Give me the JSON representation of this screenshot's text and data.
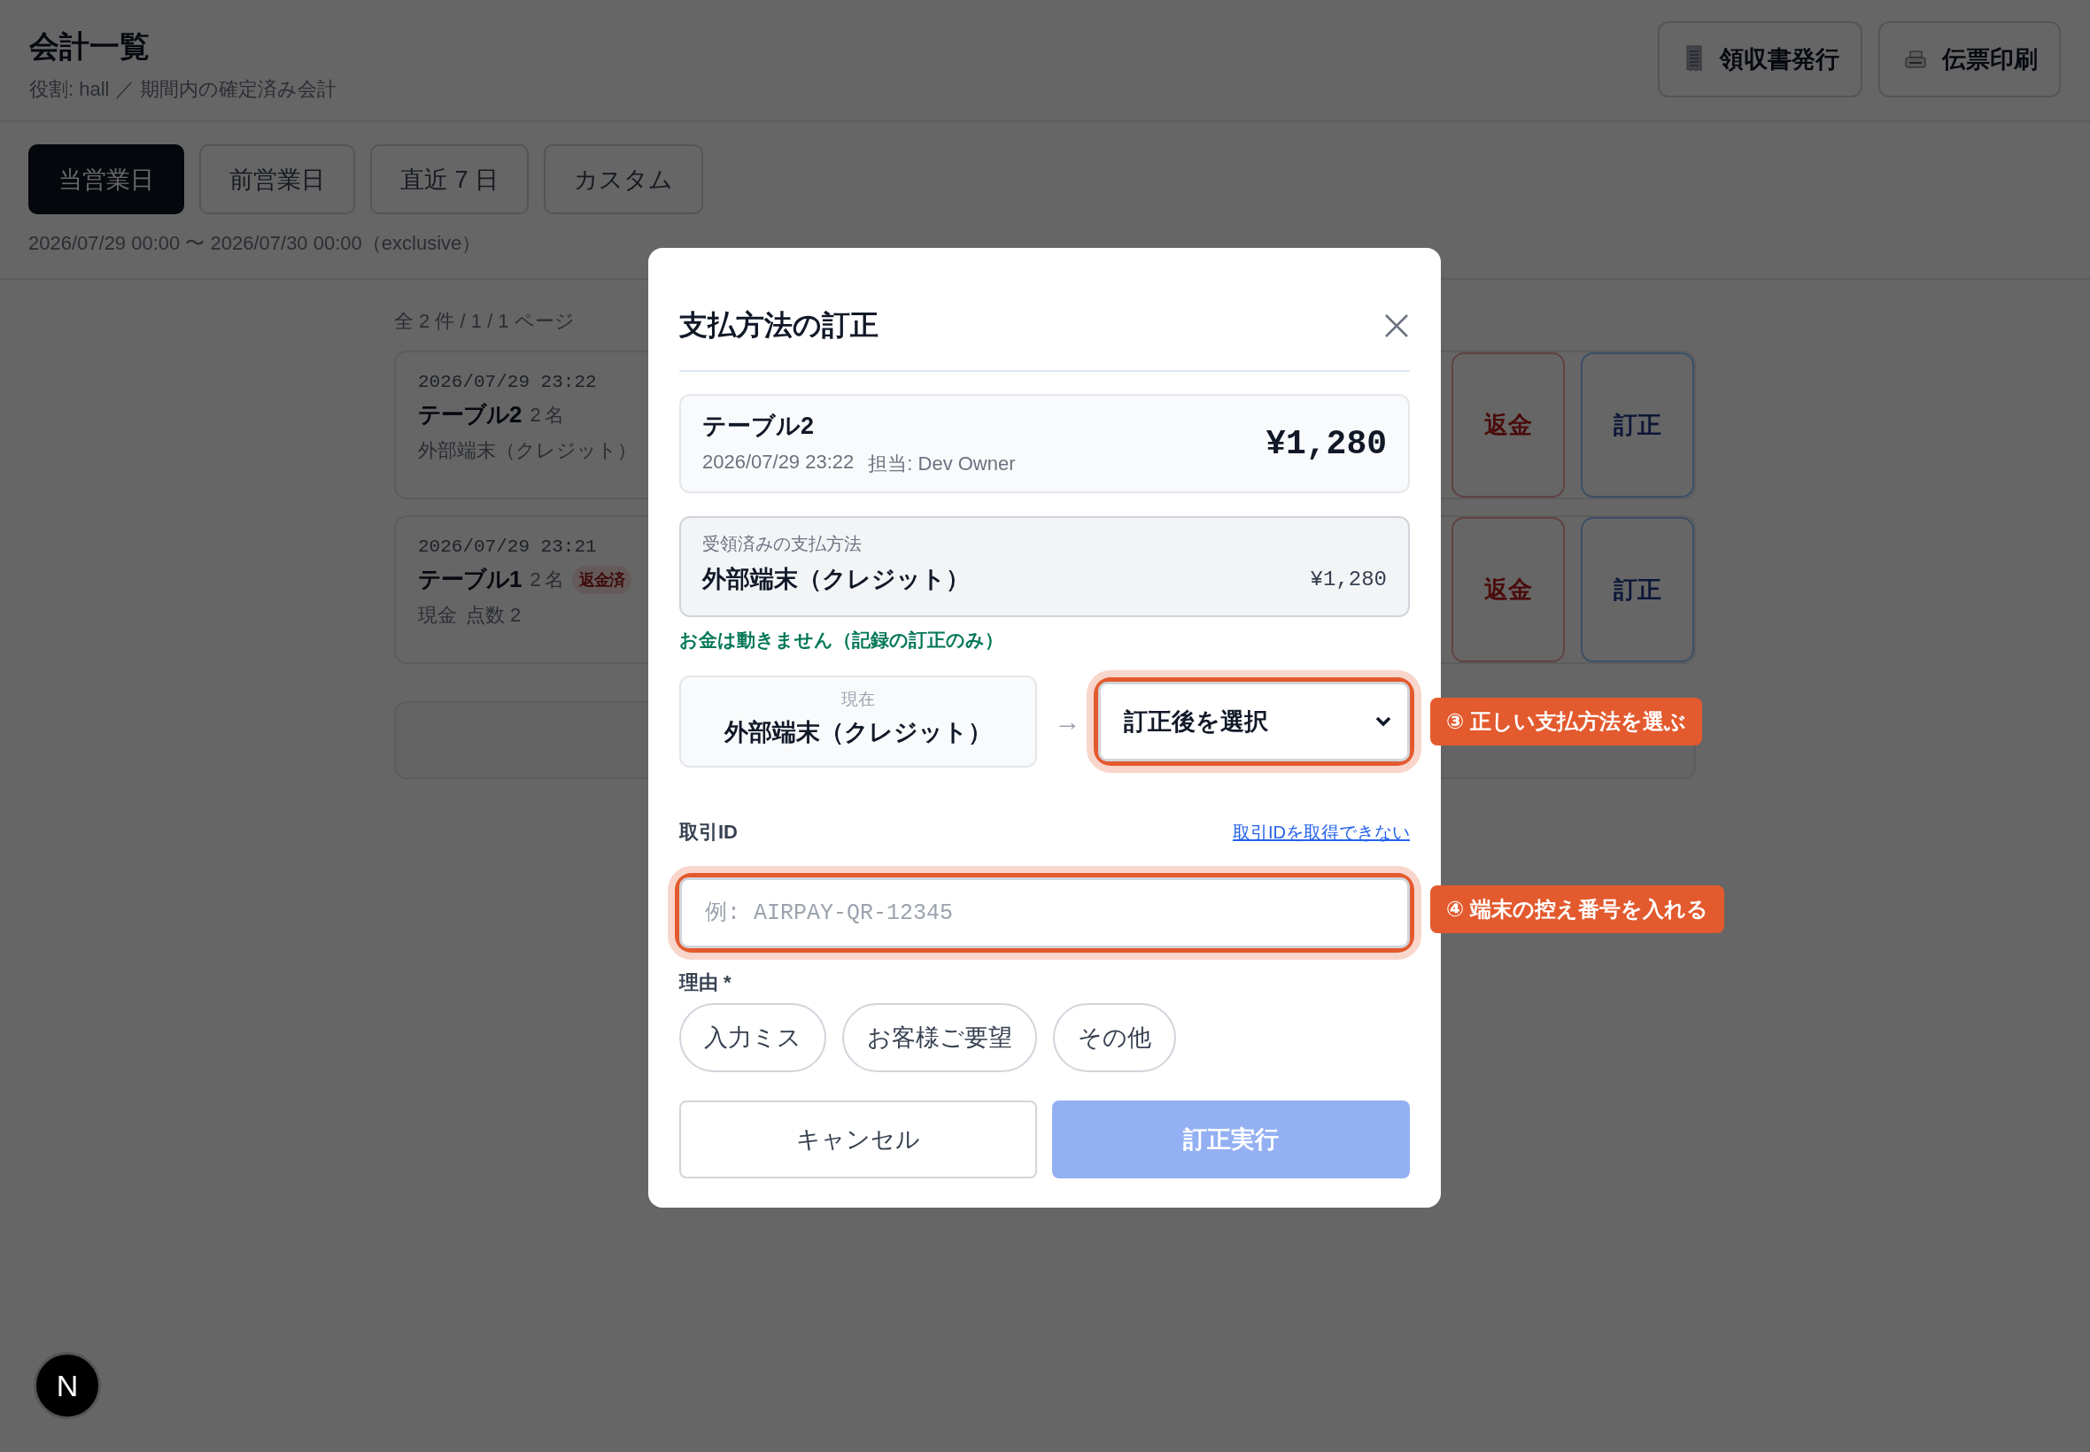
{
  "header": {
    "title": "会計一覧",
    "subtitle": "役割: hall ／ 期間内の確定済み会計"
  },
  "header_actions": [
    {
      "label": "領収書発行",
      "kind": "receipt"
    },
    {
      "label": "伝票印刷",
      "kind": "printer"
    }
  ],
  "period_tabs": [
    {
      "label": "当営業日",
      "selected": true
    },
    {
      "label": "前営業日",
      "selected": false
    },
    {
      "label": "直近 7 日",
      "selected": false
    },
    {
      "label": "カスタム",
      "selected": false
    }
  ],
  "period_range": "2026/07/29 00:00 〜 2026/07/30 00:00（exclusive）",
  "orders": {
    "summary": "全 2 件 / 1 / 1 ページ",
    "cards": [
      {
        "kind": "order",
        "time": "2026/07/29 23:22",
        "table": "テーブル2",
        "guests": "2 名",
        "payment": "外部端末（クレジット）",
        "actions": [
          {
            "label": "返金",
            "kind": "refund"
          },
          {
            "label": "訂正",
            "kind": "correct"
          }
        ]
      },
      {
        "kind": "order",
        "time": "2026/07/29 23:21",
        "table": "テーブル1",
        "guests": "2 名",
        "badge": "返金済",
        "payment": "現金",
        "items": "点数 2",
        "actions": [
          {
            "label": "返金",
            "kind": "refund"
          },
          {
            "label": "訂正",
            "kind": "correct"
          }
        ]
      },
      {
        "kind": "blank"
      }
    ]
  },
  "dialog": {
    "title": "支払方法の訂正",
    "order": {
      "table": "テーブル2",
      "time": "2026/07/29 23:22",
      "staff": "担当: Dev Owner",
      "total": "¥1,280"
    },
    "received": {
      "label": "受領済みの支払方法",
      "method": "外部端末（クレジット）",
      "amount": "¥1,280"
    },
    "note": "お金は動きません（記録の訂正のみ）",
    "current": {
      "label": "現在",
      "method": "外部端末（クレジット）"
    },
    "arrow": "→",
    "new_method": {
      "placeholder": "訂正後を選択",
      "highlighted": true
    },
    "transaction": {
      "label": "取引ID",
      "link": "取引IDを取得できない",
      "placeholder": "例: AIRPAY-QR-12345",
      "highlighted": true
    },
    "reason": {
      "label": "理由 *",
      "options": [
        {
          "label": "入力ミス",
          "selected": false
        },
        {
          "label": "お客様ご要望",
          "selected": false
        },
        {
          "label": "その他",
          "selected": false
        }
      ]
    },
    "buttons": [
      {
        "label": "キャンセル",
        "kind": "secondary",
        "disabled": false
      },
      {
        "label": "訂正実行",
        "kind": "primary",
        "disabled": true
      }
    ]
  },
  "annotations": [
    {
      "label": "③ 正しい支払方法を選ぶ"
    },
    {
      "label": "④ 端末の控え番号を入れる"
    }
  ],
  "dev_badge": {
    "label": "N"
  }
}
